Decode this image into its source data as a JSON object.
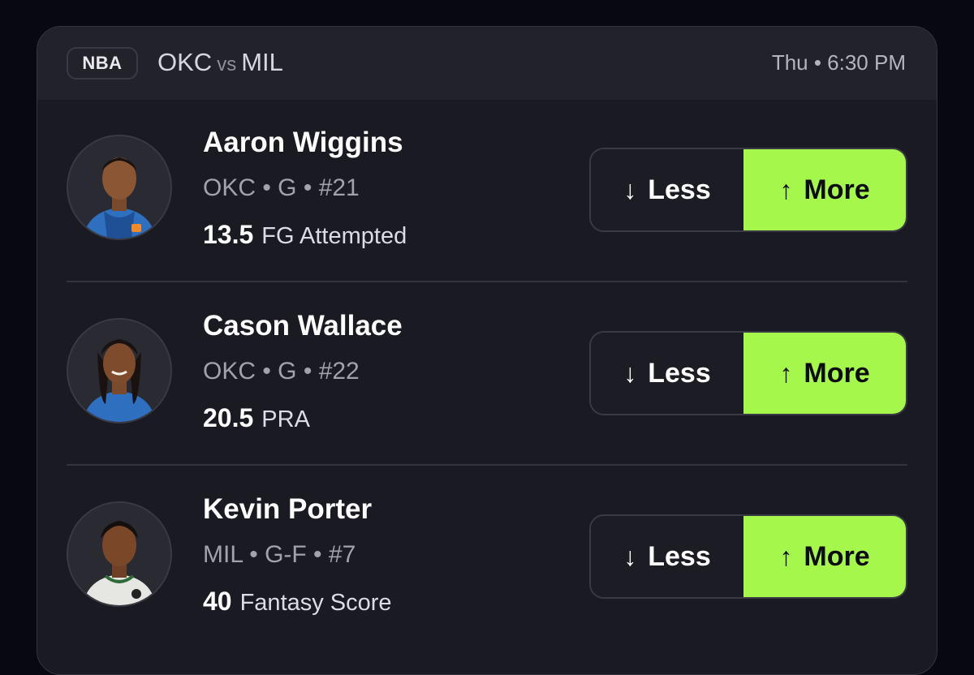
{
  "game": {
    "league": "NBA",
    "home": "OKC",
    "vs": "vs",
    "away": "MIL",
    "time": "Thu • 6:30 PM"
  },
  "buttons": {
    "less_label": "Less",
    "more_label": "More",
    "less_icon": "↓",
    "more_icon": "↑"
  },
  "players": [
    {
      "name": "Aaron Wiggins",
      "meta": "OKC • G • #21",
      "line": "13.5",
      "stat": "FG Attempted",
      "jersey_color": "#2f6fc0"
    },
    {
      "name": "Cason Wallace",
      "meta": "OKC • G • #22",
      "line": "20.5",
      "stat": "PRA",
      "jersey_color": "#2f6fc0"
    },
    {
      "name": "Kevin Porter",
      "meta": "MIL • G-F • #7",
      "line": "40",
      "stat": "Fantasy Score",
      "jersey_color": "#e6e6e2"
    }
  ],
  "colors": {
    "accent": "#a5f74c",
    "card_bg": "#1a1a22",
    "page_bg": "#080812"
  }
}
